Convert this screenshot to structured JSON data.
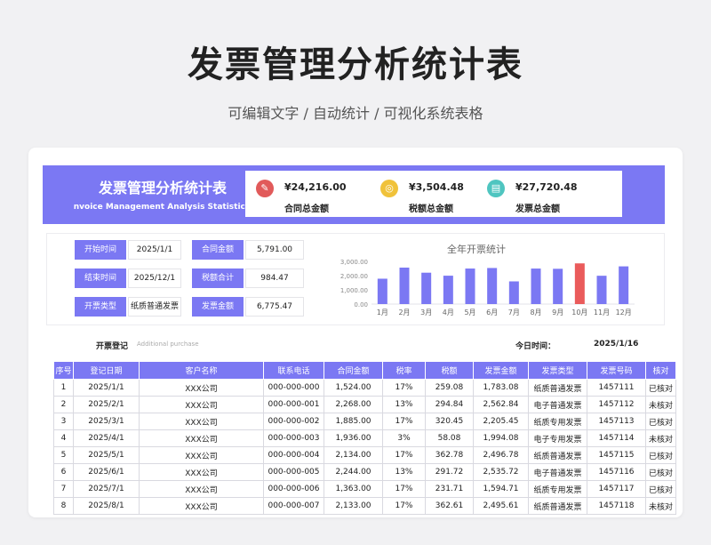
{
  "page": {
    "title": "发票管理分析统计表",
    "subtitle": "可编辑文字 / 自动统计 / 可视化系统表格"
  },
  "banner": {
    "title": "发票管理分析统计表",
    "subtitle": "nvoice Management Analysis Statistics",
    "color": "#7b78f3"
  },
  "kpis": [
    {
      "icon": "contract-icon",
      "icon_color": "#e15a5a",
      "glyph": "✎",
      "value": "¥24,216.00",
      "label": "合同总金额"
    },
    {
      "icon": "tax-coins-icon",
      "icon_color": "#f0c23a",
      "glyph": "◎",
      "value": "¥3,504.48",
      "label": "税额总金额"
    },
    {
      "icon": "invoice-ticket-icon",
      "icon_color": "#4fc5c0",
      "glyph": "▤",
      "value": "¥27,720.48",
      "label": "发票总金额"
    }
  ],
  "info": {
    "start_label": "开始时间",
    "start_value": "2025/1/1",
    "end_label": "结束时间",
    "end_value": "2025/12/1",
    "type_label": "开票类型",
    "type_value": "纸质普通发票",
    "contract_label": "合同金额",
    "contract_value": "5,791.00",
    "tax_label": "税额合计",
    "tax_value": "984.47",
    "invoice_label": "发票金额",
    "invoice_value": "6,775.47"
  },
  "chart_data": {
    "type": "bar",
    "title": "全年开票统计",
    "categories": [
      "1月",
      "2月",
      "3月",
      "4月",
      "5月",
      "6月",
      "7月",
      "8月",
      "9月",
      "10月",
      "11月",
      "12月"
    ],
    "values": [
      1783.08,
      2562.84,
      2205.45,
      1994.08,
      2496.78,
      2535.72,
      1594.71,
      2495.61,
      2480,
      2860,
      1990,
      2650
    ],
    "ylim": [
      0,
      3000
    ],
    "yticks": [
      "0.00",
      "1,000.00",
      "2,000.00",
      "3,000.00"
    ],
    "bar_color": "#7b78f3",
    "highlight_color": "#ea5b5b",
    "highlight_index": 9,
    "grid": false
  },
  "register": {
    "title": "开票登记",
    "subtitle": "Additional purchase",
    "today_label": "今日时间：",
    "today_value": "2025/1/16"
  },
  "table": {
    "columns": [
      "序号",
      "登记日期",
      "客户名称",
      "联系电话",
      "合同金额",
      "税率",
      "税额",
      "发票金额",
      "发票类型",
      "发票号码",
      "核对"
    ],
    "rows": [
      [
        "1",
        "2025/1/1",
        "XXX公司",
        "000-000-000",
        "1,524.00",
        "17%",
        "259.08",
        "1,783.08",
        "纸质普通发票",
        "1457111",
        "已核对"
      ],
      [
        "2",
        "2025/2/1",
        "XXX公司",
        "000-000-001",
        "2,268.00",
        "13%",
        "294.84",
        "2,562.84",
        "电子普通发票",
        "1457112",
        "未核对"
      ],
      [
        "3",
        "2025/3/1",
        "XXX公司",
        "000-000-002",
        "1,885.00",
        "17%",
        "320.45",
        "2,205.45",
        "纸质专用发票",
        "1457113",
        "已核对"
      ],
      [
        "4",
        "2025/4/1",
        "XXX公司",
        "000-000-003",
        "1,936.00",
        "3%",
        "58.08",
        "1,994.08",
        "电子专用发票",
        "1457114",
        "未核对"
      ],
      [
        "5",
        "2025/5/1",
        "XXX公司",
        "000-000-004",
        "2,134.00",
        "17%",
        "362.78",
        "2,496.78",
        "纸质普通发票",
        "1457115",
        "已核对"
      ],
      [
        "6",
        "2025/6/1",
        "XXX公司",
        "000-000-005",
        "2,244.00",
        "13%",
        "291.72",
        "2,535.72",
        "电子普通发票",
        "1457116",
        "已核对"
      ],
      [
        "7",
        "2025/7/1",
        "XXX公司",
        "000-000-006",
        "1,363.00",
        "17%",
        "231.71",
        "1,594.71",
        "纸质专用发票",
        "1457117",
        "已核对"
      ],
      [
        "8",
        "2025/8/1",
        "XXX公司",
        "000-000-007",
        "2,133.00",
        "17%",
        "362.61",
        "2,495.61",
        "纸质普通发票",
        "1457118",
        "未核对"
      ]
    ]
  }
}
